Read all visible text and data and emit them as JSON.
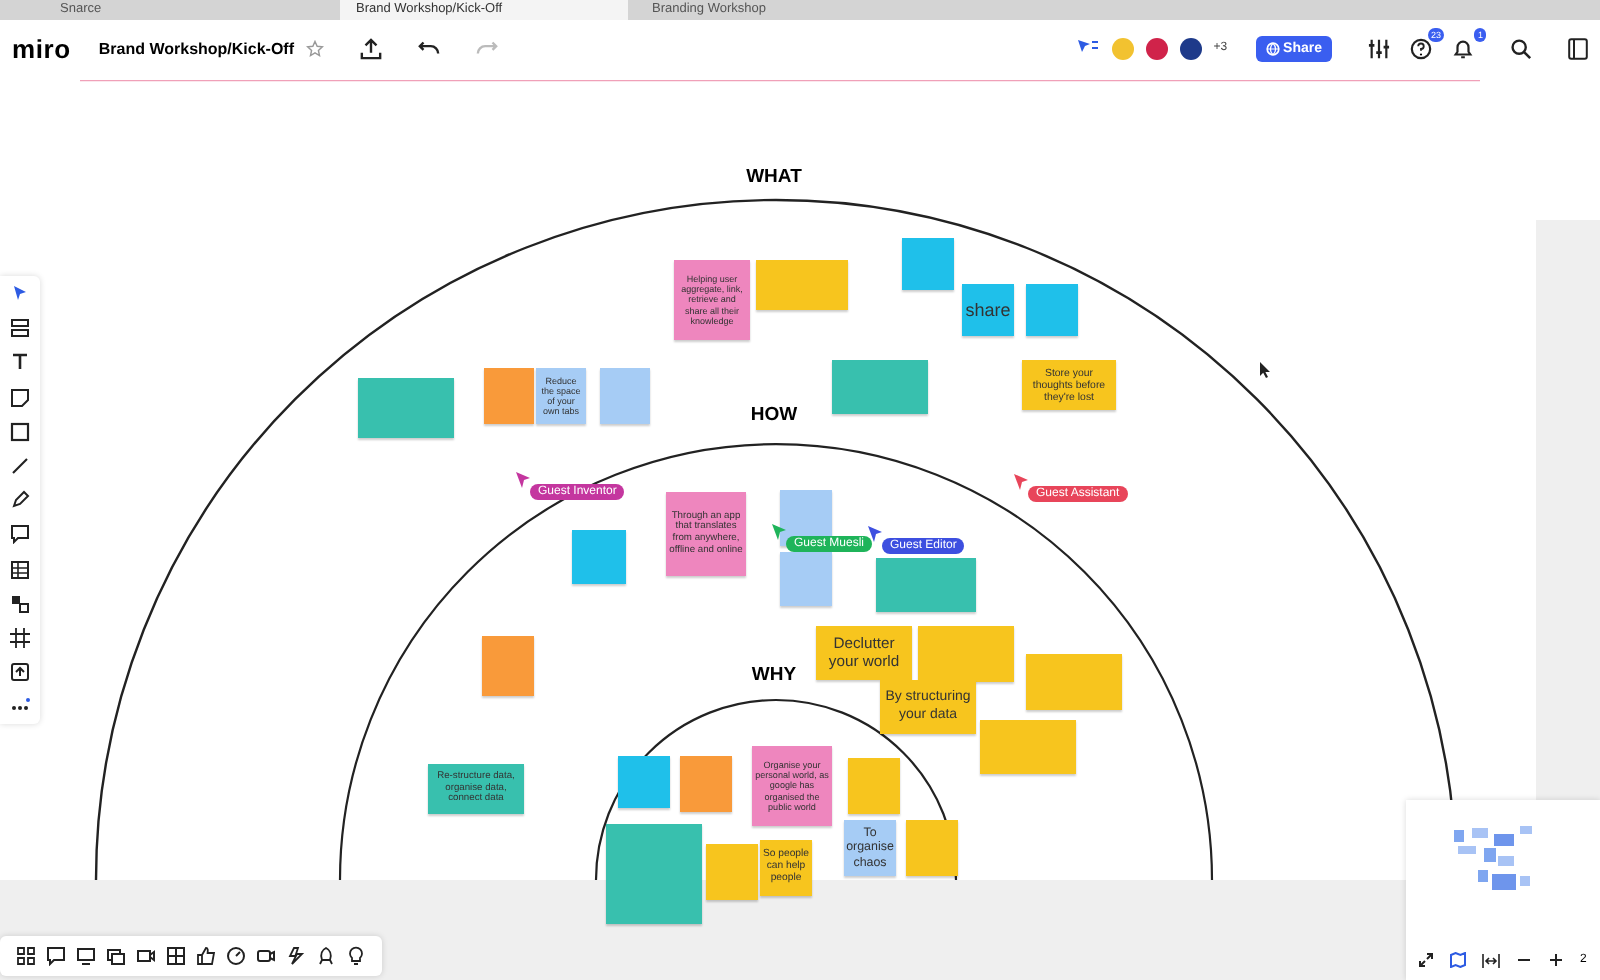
{
  "browser_tabs": [
    {
      "label": "Snarce",
      "selected": false
    },
    {
      "label": "Brand Workshop/Kick-Off",
      "selected": true
    },
    {
      "label": "Branding Workshop",
      "selected": false
    }
  ],
  "header": {
    "logo": "miro",
    "board_title": "Brand Workshop/Kick-Off",
    "collaborators_more": "+3",
    "share_button": "Share",
    "help_badge": "23",
    "notifications_badge": "1"
  },
  "board": {
    "section_labels": [
      "WHAT",
      "HOW",
      "WHY"
    ],
    "notes": [
      {
        "color": "#ee86be",
        "text": "Helping user aggregate, link, retrieve and share all their knowledge"
      },
      {
        "color": "#f7c51e"
      },
      {
        "color": "#1fc0ea"
      },
      {
        "color": "#1fc0ea",
        "text": "share"
      },
      {
        "color": "#1fc0ea"
      },
      {
        "color": "#38c0ae"
      },
      {
        "color": "#f99a3a"
      },
      {
        "color": "#a6ccf5",
        "text": "Reduce the space of your own tabs"
      },
      {
        "color": "#a6ccf5"
      },
      {
        "color": "#38c0ae"
      },
      {
        "color": "#f7c51e",
        "text": "Store your thoughts before they're lost"
      },
      {
        "color": "#1fc0ea"
      },
      {
        "color": "#ee86be",
        "text": "Through an app that translates from anywhere, offline and online"
      },
      {
        "color": "#a6ccf5"
      },
      {
        "color": "#a6ccf5"
      },
      {
        "color": "#38c0ae"
      },
      {
        "color": "#f99a3a"
      },
      {
        "color": "#f7c51e",
        "text": "Declutter your world"
      },
      {
        "color": "#f7c51e"
      },
      {
        "color": "#f7c51e",
        "text": "By structuring your data"
      },
      {
        "color": "#f7c51e"
      },
      {
        "color": "#f7c51e"
      },
      {
        "color": "#38c0ae",
        "text": "Re-structure data, organise data, connect data"
      },
      {
        "color": "#1fc0ea"
      },
      {
        "color": "#f99a3a"
      },
      {
        "color": "#ee86be",
        "text": "Organise your personal world, as google has organised the public world"
      },
      {
        "color": "#f7c51e"
      },
      {
        "color": "#38c0ae"
      },
      {
        "color": "#f7c51e"
      },
      {
        "color": "#f7c51e",
        "text": "So people can help people"
      },
      {
        "color": "#a6ccf5",
        "text": "To organise chaos"
      },
      {
        "color": "#f7c51e"
      }
    ],
    "cursors": [
      {
        "label": "Guest Inventor",
        "color": "#c4369f"
      },
      {
        "label": "Guest Muesli",
        "color": "#1fb45a"
      },
      {
        "label": "Guest Editor",
        "color": "#3d4fe0"
      },
      {
        "label": "Guest Assistant",
        "color": "#e8455a"
      }
    ]
  },
  "zoom_controls": {
    "zoom_level": "2"
  }
}
